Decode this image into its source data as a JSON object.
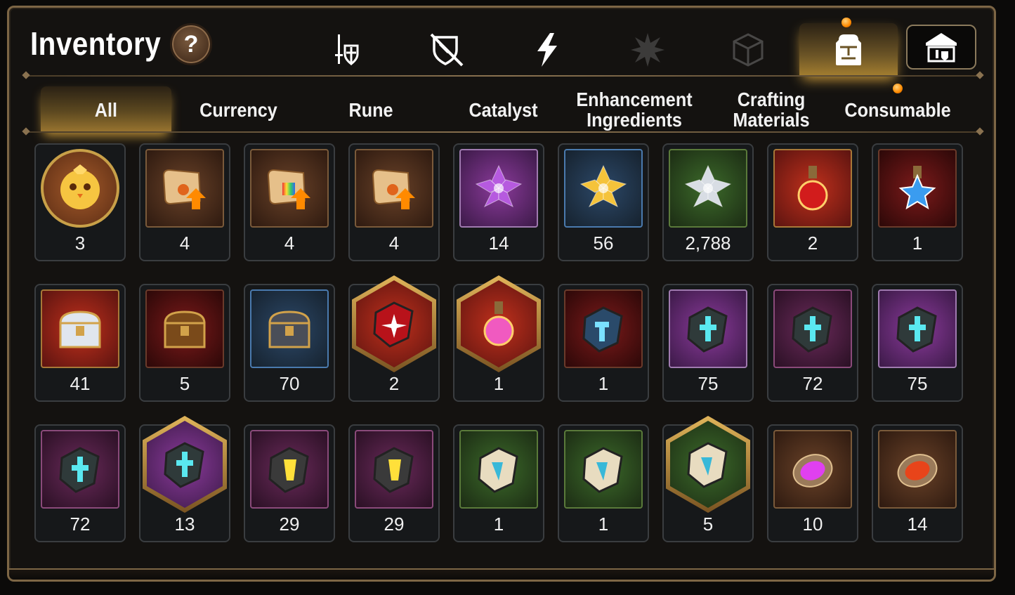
{
  "title": "Inventory",
  "help_label": "?",
  "category_tabs": [
    {
      "icon": "sword-shield-icon",
      "active": false
    },
    {
      "icon": "broken-shield-icon",
      "active": false
    },
    {
      "icon": "lightning-icon",
      "active": false
    },
    {
      "icon": "burst-emblem-icon",
      "active": false
    },
    {
      "icon": "cube-icon",
      "active": false
    },
    {
      "icon": "backpack-icon",
      "active": true
    }
  ],
  "guild_button_icon": "guild-hall-icon",
  "sub_tabs": [
    {
      "label": "All",
      "active": true
    },
    {
      "label": "Currency",
      "active": false
    },
    {
      "label": "Rune",
      "active": false
    },
    {
      "label": "Catalyst",
      "active": false
    },
    {
      "label": "Enhancement Ingredients",
      "active": false
    },
    {
      "label": "Crafting Materials",
      "active": false
    },
    {
      "label": "Consumable",
      "active": false
    }
  ],
  "items": [
    {
      "icon": "chick-mascot-icon",
      "qty": "3",
      "frame": "round",
      "bg": "orange"
    },
    {
      "icon": "scroll-upgrade-icon",
      "qty": "4",
      "frame": "square",
      "bg": "brown"
    },
    {
      "icon": "rainbow-scroll-upgrade-icon",
      "qty": "4",
      "frame": "square",
      "bg": "brown"
    },
    {
      "icon": "scroll-upgrade-icon",
      "qty": "4",
      "frame": "square",
      "bg": "brown"
    },
    {
      "icon": "purple-crystal-flower-icon",
      "qty": "14",
      "frame": "square",
      "bg": "purple"
    },
    {
      "icon": "gold-crystal-flower-icon",
      "qty": "56",
      "frame": "square",
      "bg": "blue"
    },
    {
      "icon": "silver-crystal-flower-icon",
      "qty": "2,788",
      "frame": "square",
      "bg": "green"
    },
    {
      "icon": "red-potion-icon",
      "qty": "2",
      "frame": "square",
      "bg": "red"
    },
    {
      "icon": "blue-star-potion-icon",
      "qty": "1",
      "frame": "square",
      "bg": "crimson"
    },
    {
      "icon": "silver-chest-icon",
      "qty": "41",
      "frame": "square",
      "bg": "red"
    },
    {
      "icon": "wooden-chest-icon",
      "qty": "5",
      "frame": "square",
      "bg": "crimson"
    },
    {
      "icon": "dark-chest-icon",
      "qty": "70",
      "frame": "square",
      "bg": "blue"
    },
    {
      "icon": "red-rune-stone-icon",
      "qty": "2",
      "frame": "hex",
      "bg": "red"
    },
    {
      "icon": "pink-potion-icon",
      "qty": "1",
      "frame": "hex",
      "bg": "red"
    },
    {
      "icon": "hammer-rune-icon",
      "qty": "1",
      "frame": "square",
      "bg": "crimson"
    },
    {
      "icon": "sword-rune-stone-icon",
      "qty": "75",
      "frame": "square",
      "bg": "purple"
    },
    {
      "icon": "spiral-rune-stone-icon",
      "qty": "72",
      "frame": "square",
      "bg": "magenta"
    },
    {
      "icon": "armor-rune-stone-icon",
      "qty": "75",
      "frame": "square",
      "bg": "purple"
    },
    {
      "icon": "boot-rune-stone-icon",
      "qty": "72",
      "frame": "square",
      "bg": "magenta"
    },
    {
      "icon": "cross-rune-stone-icon",
      "qty": "13",
      "frame": "hex",
      "bg": "purple"
    },
    {
      "icon": "hammer-rune-stone-icon",
      "qty": "29",
      "frame": "square",
      "bg": "magenta"
    },
    {
      "icon": "slash-rune-stone-icon",
      "qty": "29",
      "frame": "square",
      "bg": "magenta"
    },
    {
      "icon": "sword-pale-stone-icon",
      "qty": "1",
      "frame": "square",
      "bg": "green"
    },
    {
      "icon": "boot-pale-stone-icon",
      "qty": "1",
      "frame": "square",
      "bg": "green"
    },
    {
      "icon": "cross-pale-stone-icon",
      "qty": "5",
      "frame": "hex",
      "bg": "green"
    },
    {
      "icon": "purple-orb-icon",
      "qty": "10",
      "frame": "square",
      "bg": "brown"
    },
    {
      "icon": "lava-orb-icon",
      "qty": "14",
      "frame": "square",
      "bg": "brown"
    }
  ],
  "colors": {
    "frame_border": "#7d6645",
    "active_tab": "#9b7630",
    "notification_dot": "#ff8a00"
  }
}
